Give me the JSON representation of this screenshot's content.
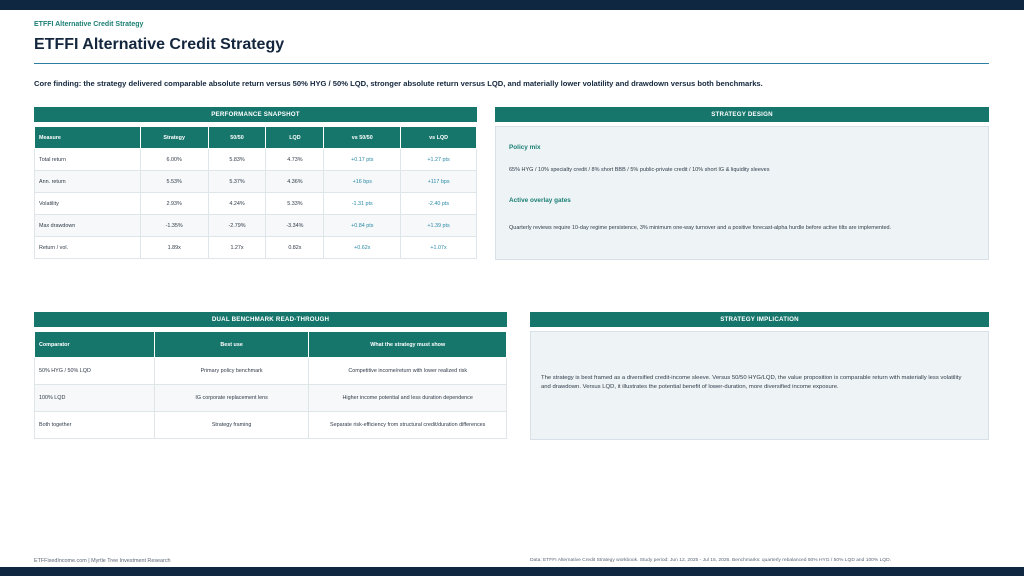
{
  "header": {
    "kicker": "ETFFI Alternative Credit Strategy",
    "title": "ETFFI Alternative Credit Strategy",
    "finding": "Core finding: the strategy delivered comparable absolute return versus 50% HYG / 50% LQD, stronger absolute return versus LQD, and materially lower volatility and drawdown versus both benchmarks."
  },
  "performance": {
    "heading": "Performance Snapshot",
    "columns": [
      "Measure",
      "Strategy",
      "50/50",
      "LQD",
      "vs 50/50",
      "vs LQD"
    ],
    "rows": [
      [
        "Total return",
        "6.00%",
        "5.83%",
        "4.73%",
        "+0.17 pts",
        "+1.27 pts"
      ],
      [
        "Ann. return",
        "5.53%",
        "5.37%",
        "4.36%",
        "+16 bps",
        "+117 bps"
      ],
      [
        "Volatility",
        "2.93%",
        "4.24%",
        "5.33%",
        "-1.31 pts",
        "-2.40 pts"
      ],
      [
        "Max drawdown",
        "-1.35%",
        "-2.79%",
        "-3.34%",
        "+0.84 pts",
        "+1.39 pts"
      ],
      [
        "Return / vol.",
        "1.89x",
        "1.27x",
        "0.82x",
        "+0.62x",
        "+1.07x"
      ]
    ]
  },
  "design": {
    "heading": "Strategy Design",
    "policy_title": "Policy mix",
    "policy_text": "65% HYG / 10% specialty credit / 8% short BBB / 5% public-private credit / 10% short IG & liquidity sleeves",
    "overlay_title": "Active overlay gates",
    "overlay_text": "Quarterly reviews require 10-day regime persistence, 3% minimum one-way turnover and a positive forecast-alpha hurdle before active tilts are implemented."
  },
  "benchmark": {
    "heading": "Dual Benchmark Read-Through",
    "columns": [
      "Comparator",
      "Best use",
      "What the strategy must show"
    ],
    "rows": [
      [
        "50% HYG / 50% LQD",
        "Primary policy benchmark",
        "Competitive income/return with lower realized risk"
      ],
      [
        "100% LQD",
        "IG corporate replacement lens",
        "Higher income potential and less duration dependence"
      ],
      [
        "Both together",
        "Strategy framing",
        "Separate risk-efficiency from structural credit/duration differences"
      ]
    ]
  },
  "implication": {
    "heading": "Strategy Implication",
    "text": "The strategy is best framed as a diversified credit-income sleeve. Versus 50/50 HYG/LQD, the value proposition is comparable return with materially less volatility and drawdown. Versus LQD, it illustrates the potential benefit of lower-duration, more diversified income exposure."
  },
  "footer": {
    "left": "ETFFixedIncome.com | Myrtle Tree Investment Research",
    "right": "Data: ETFFI Alternative Credit Strategy workbook. Study period: Jun 12, 2025 - Jul 15, 2026. Benchmarks: quarterly rebalanced 50% HYG / 50% LQD and 100% LQD."
  }
}
